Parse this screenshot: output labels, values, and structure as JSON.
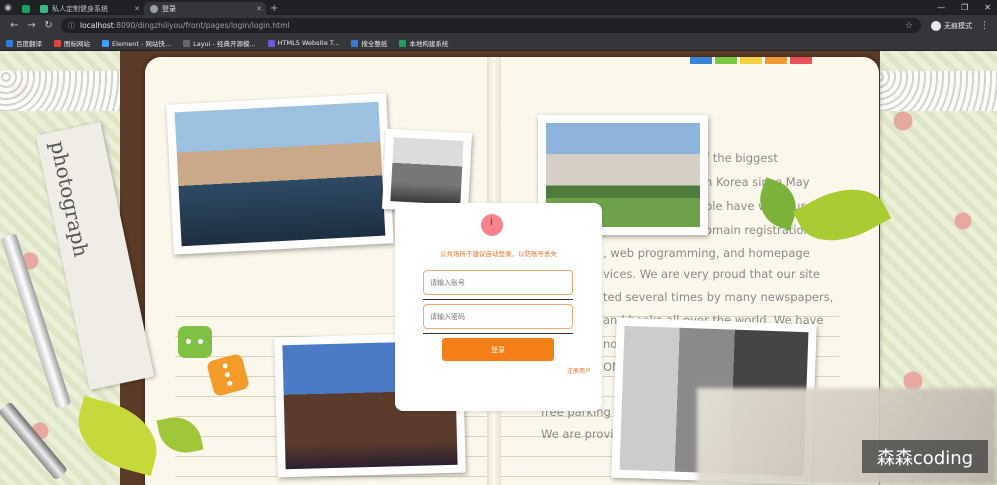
{
  "browser": {
    "tabs": [
      {
        "title": "",
        "active": false,
        "favicon": "github-icon"
      },
      {
        "title": "",
        "active": false,
        "favicon": "green-icon"
      },
      {
        "title": "私人定制健身系统",
        "active": false,
        "favicon": "vue-icon"
      },
      {
        "title": "登录",
        "active": true,
        "favicon": "globe-icon"
      }
    ],
    "url_host": "localhost",
    "url_path": ":8090/dingzhiliyou/front/pages/login/login.html",
    "profile_label": "无痕模式",
    "bookmarks": [
      {
        "label": "百度翻译",
        "color": "#2e7dd7"
      },
      {
        "label": "图标网站",
        "color": "#e04545"
      },
      {
        "label": "Element - 网站快...",
        "color": "#409eff"
      },
      {
        "label": "Layui - 经典开源模...",
        "color": "#666666"
      },
      {
        "label": "HTML5 Website T...",
        "color": "#7155e0"
      },
      {
        "label": "搜全整纸",
        "color": "#3c78d8"
      },
      {
        "label": "本地构建系统",
        "color": "#1aa260"
      }
    ]
  },
  "background_text": {
    "lines": [
      "f the biggest",
      "n Korea since May",
      "ple have with our",
      "omain registration",
      ", web programming, and homepage",
      "vices. We are very proud that  our site",
      "ted several times by many newspapers,",
      "and books all over the world. We have",
      "no",
      "OM",
      "free parking a",
      "We are provid"
    ],
    "newspaper_title": "photograph"
  },
  "login": {
    "tip": "公共场所不建议自动登录，以防账号丢失",
    "username_placeholder": "请输入账号",
    "password_placeholder": "请输入密码",
    "submit_label": "登录",
    "register_label": "注册用户"
  },
  "watermark": "森森coding",
  "colors": {
    "accent": "#f57f17",
    "tip_text": "#e6732b",
    "field_border": "#f0a873"
  }
}
